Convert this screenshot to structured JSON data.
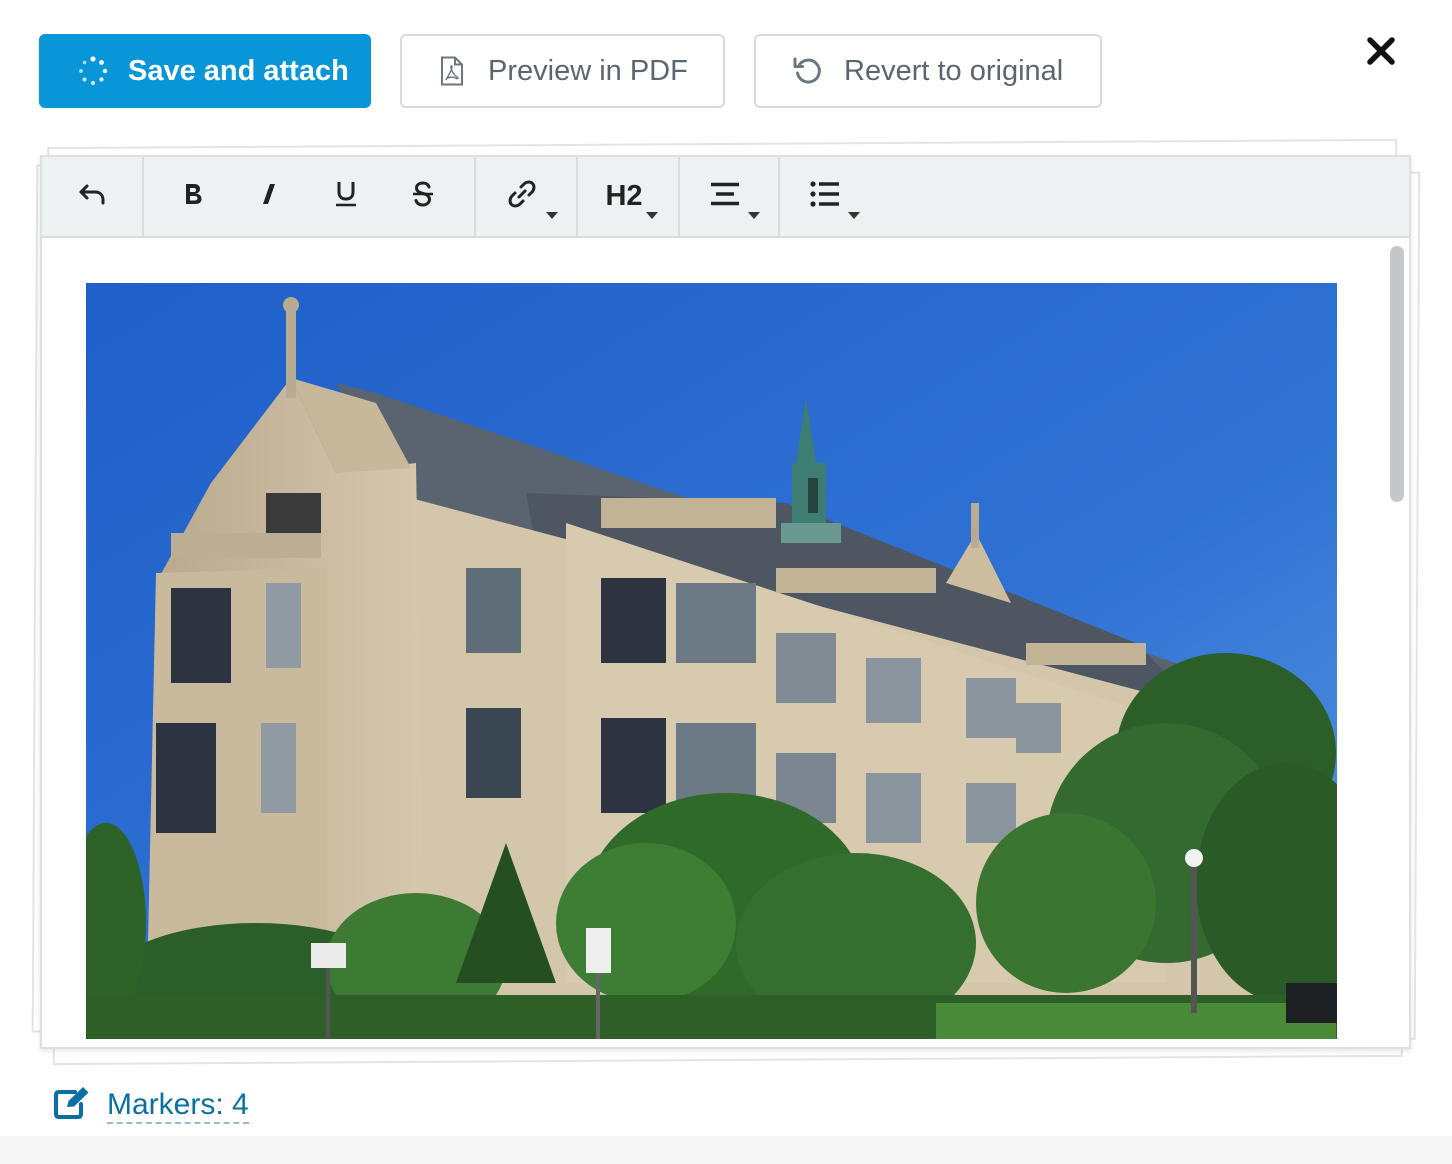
{
  "actions": {
    "save_label": "Save and attach",
    "preview_label": "Preview in PDF",
    "revert_label": "Revert to original"
  },
  "toolbar": {
    "heading_label": "H2",
    "items": [
      "undo",
      "bold",
      "italic",
      "underline",
      "strikethrough",
      "link",
      "heading",
      "align",
      "list"
    ]
  },
  "markers": {
    "label": "Markers: 4"
  },
  "colors": {
    "primary": "#0896d8",
    "link": "#0b6fa3",
    "sky": "#2d6ed0",
    "stone": "#cbbba0"
  },
  "icons": {
    "save": "spinner-icon",
    "preview": "pdf-file-icon",
    "revert": "undo-circle-icon",
    "close": "close-icon",
    "markers": "edit-icon"
  }
}
